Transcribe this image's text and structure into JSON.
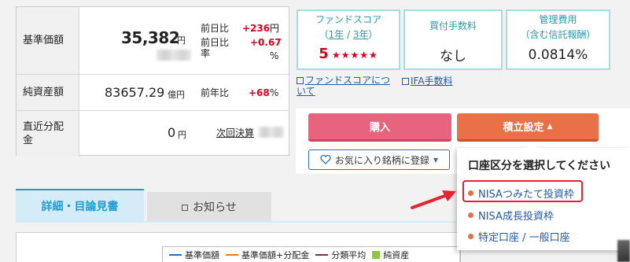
{
  "price_table": {
    "nav": {
      "label": "基準価額",
      "value": "35,382",
      "unit": "円",
      "change_label": "前日比",
      "change_value": "+236",
      "change_unit": "円",
      "rate_label": "前日比率",
      "rate_value": "+0.67",
      "rate_unit": "%"
    },
    "net_assets": {
      "label": "純資産額",
      "value": "83657.29",
      "unit": "億円",
      "change_label": "前年比",
      "change_value": "+68",
      "change_unit": "%"
    },
    "distribution": {
      "label": "直近分配金",
      "value": "0",
      "unit": "円",
      "link": "次回決算"
    }
  },
  "scores": {
    "fund_score": {
      "title": "ファンドスコア",
      "period_1y": "1年",
      "period_sep": " / ",
      "period_3y": "3年",
      "paren_open": "（",
      "paren_close": "）",
      "number": "5",
      "stars": "★★★★★",
      "star_count": 5
    },
    "purchase_fee": {
      "title": "買付手数料",
      "value": "なし"
    },
    "management_fee": {
      "title": "管理費用",
      "subtitle": "（含む信託報酬）",
      "value": "0.0814%"
    }
  },
  "links": {
    "about_score": "ファンドスコアについて",
    "ifa_fee": "IFA手数料"
  },
  "actions": {
    "buy": "購入",
    "tsumitate": "積立設定",
    "tsumitate_caret": "▲",
    "favorite": "お気に入り銘柄に登録",
    "favorite_caret": "▼"
  },
  "dropdown": {
    "title": "口座区分を選択してください",
    "items": [
      "NISAつみたて投資枠",
      "NISA成長投資枠",
      "特定口座 / 一般口座"
    ]
  },
  "tabs": {
    "detail": "詳細・目論見書",
    "news": "お知らせ"
  },
  "legend": {
    "items": [
      {
        "label": "基準価額",
        "color": "#1f6fd1",
        "kind": "line"
      },
      {
        "label": "基準価額+分配金",
        "color": "#e77c1e",
        "kind": "line"
      },
      {
        "label": "分類平均",
        "color": "#8a2a4a",
        "kind": "line"
      },
      {
        "label": "純資産",
        "color": "#8dc63f",
        "kind": "box"
      }
    ]
  },
  "colors": {
    "accent_teal": "#2c9aa8",
    "score_red": "#d3001f",
    "buy": "#e8637d",
    "tsumitate": "#ea7048",
    "tab_blue": "#1e9bd7",
    "highlight_red": "#e8222f"
  }
}
